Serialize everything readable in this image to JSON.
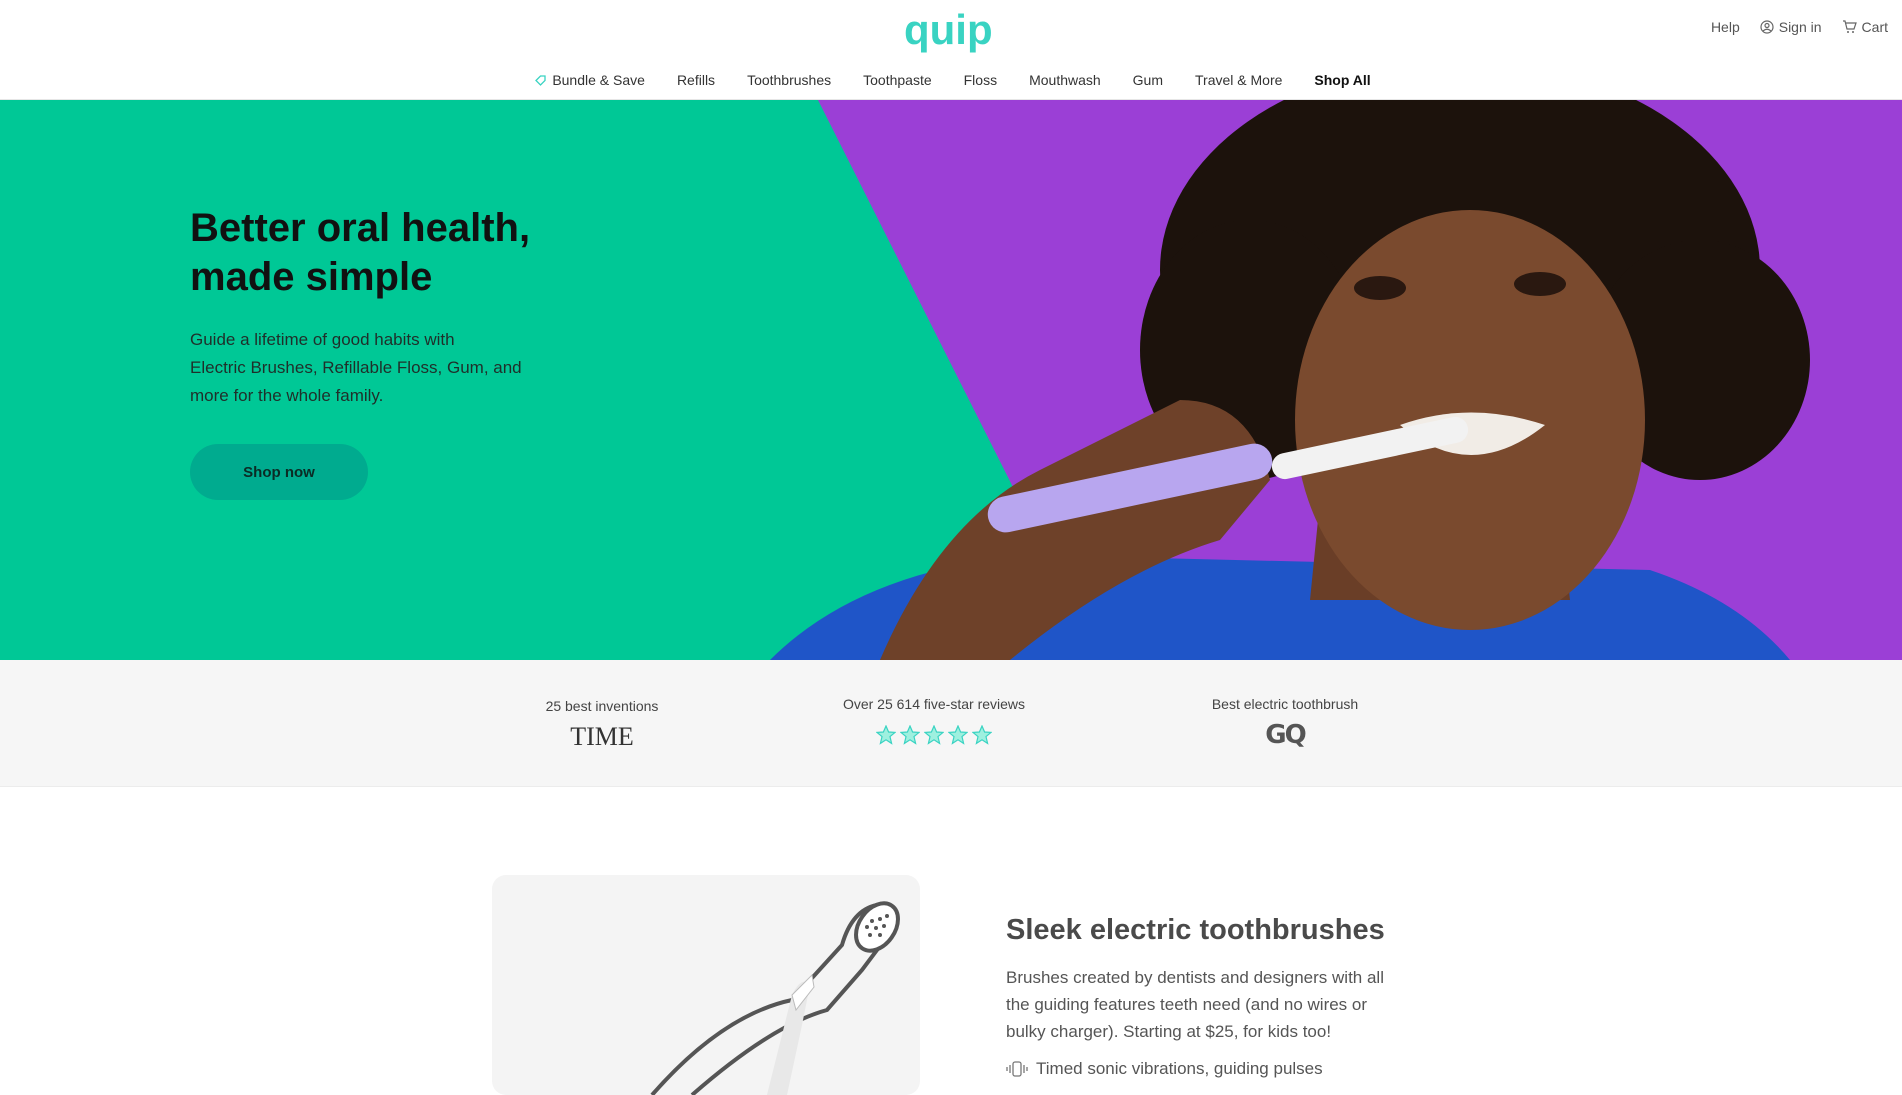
{
  "brand": {
    "logo_text": "quip",
    "accent": "#39d3c2"
  },
  "utility_nav": {
    "help": "Help",
    "sign_in": "Sign in",
    "cart": "Cart"
  },
  "nav": {
    "items": [
      {
        "label": "Bundle & Save",
        "icon": "tag-icon"
      },
      {
        "label": "Refills"
      },
      {
        "label": "Toothbrushes"
      },
      {
        "label": "Toothpaste"
      },
      {
        "label": "Floss"
      },
      {
        "label": "Mouthwash"
      },
      {
        "label": "Gum"
      },
      {
        "label": "Travel & More"
      },
      {
        "label": "Shop All"
      }
    ]
  },
  "hero": {
    "title_line1": "Better oral health,",
    "title_line2": "made simple",
    "subtitle_line1": "Guide a lifetime of good habits with",
    "subtitle_line2": "Electric Brushes, Refillable Floss, Gum, and",
    "subtitle_line3": "more for the whole family.",
    "cta": "Shop now",
    "colors": {
      "green": "#00c896",
      "purple": "#9b3fd6",
      "shirt": "#1f55c8",
      "brush": "#b8a6ef"
    }
  },
  "press": {
    "items": [
      {
        "caption": "25 best inventions",
        "logo": "TIME"
      },
      {
        "caption": "Over 25 614 five-star reviews",
        "stars": 5
      },
      {
        "caption": "Best electric toothbrush",
        "logo": "GQ"
      }
    ]
  },
  "feature": {
    "title": "Sleek electric toothbrushes",
    "body_line1": "Brushes created by dentists and designers with all",
    "body_line2": "the guiding features teeth need (and no wires or",
    "body_line3": "bulky charger). Starting at $25, for kids too!",
    "point": "Timed sonic vibrations, guiding pulses",
    "point_icon": "vibration-icon"
  }
}
